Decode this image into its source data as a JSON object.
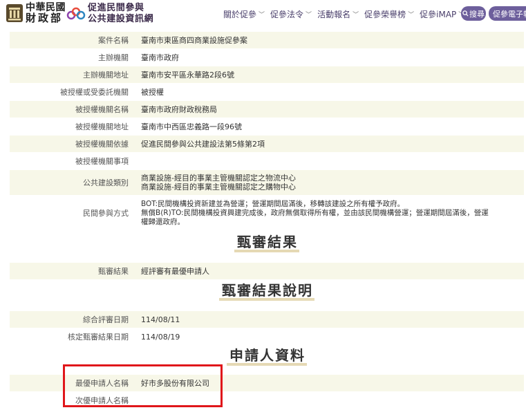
{
  "header": {
    "mof_name_line1": "中華民國",
    "mof_name_line2": "財政部",
    "ppp_name_line1": "促進民間參與",
    "ppp_name_line2": "公共建設資訊網",
    "nav": [
      {
        "label": "關於促參"
      },
      {
        "label": "促參法令"
      },
      {
        "label": "活動報名"
      },
      {
        "label": "促參榮譽榜"
      },
      {
        "label": "促參iMAP"
      }
    ],
    "search_label": "搜尋",
    "e_button_label": "促參電子報",
    "search_icon": "search-icon",
    "caret_icon": "chevron-down-icon"
  },
  "details": [
    {
      "label": "案件名稱",
      "value": [
        "臺南市東區商四商業設施促參案"
      ]
    },
    {
      "label": "主辦機關",
      "value": [
        "臺南市政府"
      ]
    },
    {
      "label": "主辦機關地址",
      "value": [
        "臺南市安平區永華路2段6號"
      ]
    },
    {
      "label": "被授權或受委託機關",
      "value": [
        "被授權"
      ]
    },
    {
      "label": "被授權機關名稱",
      "value": [
        "臺南市政府財政稅務局"
      ]
    },
    {
      "label": "被授權機關地址",
      "value": [
        "臺南市中西區忠義路一段96號"
      ]
    },
    {
      "label": "被授權機關依據",
      "value": [
        "促進民間參與公共建設法第5條第2項"
      ]
    },
    {
      "label": "被授權機關事項",
      "value": [
        ""
      ]
    },
    {
      "label": "公共建設類別",
      "value": [
        "商業設施-經目的事業主管機關認定之物流中心",
        "商業設施-經目的事業主管機關認定之購物中心"
      ]
    },
    {
      "label": "民間參與方式",
      "value": [
        "BOT:民間機構投資新建並為營運；營運期間屆滿後，移轉該建設之所有權予政府。",
        "無償B(R)TO:民間機構投資興建完成後，政府無償取得所有權，並由該民間機構營運；營運期間屆滿後，營運",
        "權歸還政府。"
      ]
    }
  ],
  "section_review": {
    "title": "甄審結果",
    "rows": [
      {
        "label": "甄審結果",
        "value": [
          "經評審有最優申請人"
        ]
      }
    ]
  },
  "section_review_desc": {
    "title": "甄審結果說明",
    "rows": [
      {
        "label": "綜合評審日期",
        "value": [
          "114/08/11"
        ]
      },
      {
        "label": "核定甄審結果日期",
        "value": [
          "114/08/19"
        ]
      }
    ]
  },
  "section_applicant": {
    "title": "申請人資料",
    "rows": [
      {
        "label": "最優申請人名稱",
        "value": [
          "好市多股份有限公司"
        ]
      },
      {
        "label": "次優申請人名稱",
        "value": [
          ""
        ]
      }
    ]
  },
  "colors": {
    "accent": "#6d5f9c",
    "row_alt": "#f7f7e8",
    "highlight_border": "#e0161a",
    "title_underline": "#e5d9b4"
  }
}
